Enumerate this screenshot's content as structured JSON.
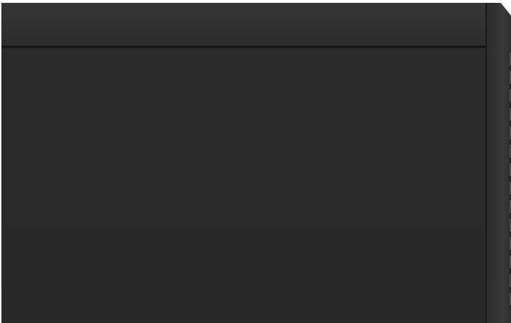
{
  "image": {
    "subject": "",
    "colors": {
      "background": "#ffffff",
      "box_body": "#2a2a2b",
      "lid": "#323234",
      "seam": "#151516",
      "side_panel": "#343436"
    }
  }
}
